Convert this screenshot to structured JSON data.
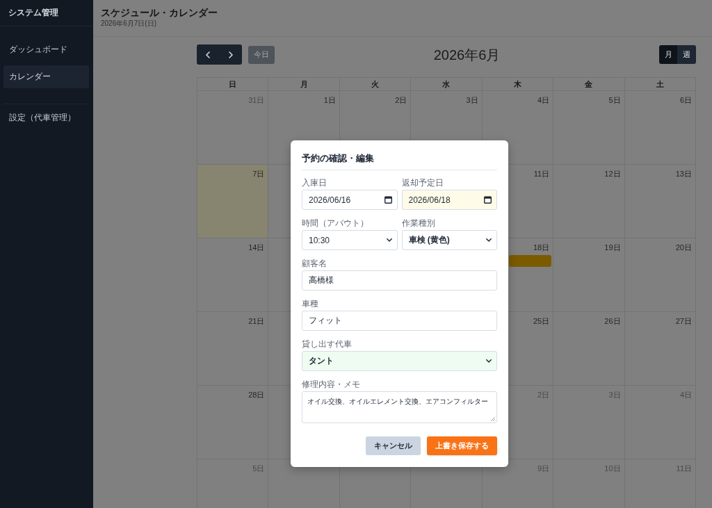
{
  "sidebar": {
    "title": "システム管理",
    "items": [
      {
        "label": "ダッシュボード",
        "selected": false
      },
      {
        "label": "カレンダー",
        "selected": true
      }
    ],
    "bottom_items": [
      {
        "label": "設定（代車管理）",
        "selected": false
      }
    ]
  },
  "header": {
    "title": "スケジュール・カレンダー",
    "date": "2026年6月7日(日)"
  },
  "toolbar": {
    "today_button": {
      "label": "今日",
      "disabled": true
    },
    "month_title": "2026年6月",
    "view_toggle": [
      {
        "label": "月",
        "selected": true
      },
      {
        "label": "週",
        "selected": false
      }
    ]
  },
  "calendar": {
    "weekdays": [
      "日",
      "月",
      "火",
      "水",
      "木",
      "金",
      "土"
    ],
    "weeks": [
      {
        "cells": [
          {
            "day": "31日",
            "other_month": true,
            "today": false
          },
          {
            "day": "1日",
            "other_month": false,
            "today": false
          },
          {
            "day": "2日",
            "other_month": false,
            "today": false
          },
          {
            "day": "3日",
            "other_month": false,
            "today": false
          },
          {
            "day": "4日",
            "other_month": false,
            "today": false
          },
          {
            "day": "5日",
            "other_month": false,
            "today": false
          },
          {
            "day": "6日",
            "other_month": false,
            "today": false
          }
        ]
      },
      {
        "cells": [
          {
            "day": "7日",
            "other_month": false,
            "today": true
          }
        ],
        "cells_right_of_dialog": [
          {
            "day": "11日",
            "other_month": false,
            "today": false
          },
          {
            "day": "12日",
            "other_month": false,
            "today": false
          },
          {
            "day": "13日",
            "other_month": false,
            "today": false
          }
        ]
      },
      {
        "cells": [
          {
            "day": "14日",
            "other_month": false,
            "today": false
          }
        ],
        "cells_right_of_dialog": [
          {
            "day": "18日",
            "other_month": false,
            "today": false,
            "events": [
              {
                "color": "#7b5b00"
              }
            ]
          },
          {
            "day": "19日",
            "other_month": false,
            "today": false
          },
          {
            "day": "20日",
            "other_month": false,
            "today": false
          }
        ]
      },
      {
        "cells": [
          {
            "day": "21日",
            "other_month": false,
            "today": false
          }
        ],
        "cells_right_of_dialog": [
          {
            "day": "25日",
            "other_month": false,
            "today": false
          },
          {
            "day": "26日",
            "other_month": false,
            "today": false
          },
          {
            "day": "27日",
            "other_month": false,
            "today": false
          }
        ]
      },
      {
        "cells": [
          {
            "day": "28日",
            "other_month": false,
            "today": false
          }
        ],
        "cells_right_of_dialog": [
          {
            "day": "2日",
            "other_month": true,
            "today": false
          },
          {
            "day": "3日",
            "other_month": true,
            "today": false
          },
          {
            "day": "4日",
            "other_month": true,
            "today": false
          }
        ]
      },
      {
        "cells": [
          {
            "day": "5日",
            "other_month": true,
            "today": false
          }
        ],
        "cells_right_of_dialog": [
          {
            "day": "9日",
            "other_month": true,
            "today": false
          },
          {
            "day": "10日",
            "other_month": true,
            "today": false
          },
          {
            "day": "11日",
            "other_month": true,
            "today": false
          }
        ]
      }
    ]
  },
  "modal": {
    "title": "予約の確認・編集",
    "rows": [
      [
        {
          "label": "入庫日",
          "kind": "date",
          "value": "2026/06/16",
          "color": "#ffffff",
          "strong": false
        },
        {
          "label": "返却予定日",
          "kind": "date",
          "value": "2026/06/18",
          "color": "#fefbe8",
          "strong": false
        }
      ],
      [
        {
          "label": "時間（アバウト）",
          "kind": "select",
          "value": "10:30",
          "color": "#ffffff",
          "strong": false
        },
        {
          "label": "作業種別",
          "kind": "select",
          "value": "車検 (黄色)",
          "color": "#ffffff",
          "strong": true
        }
      ],
      [
        {
          "label": "顧客名",
          "kind": "text",
          "value": "高橋様",
          "color": "#ffffff",
          "strong": false
        }
      ],
      [
        {
          "label": "車種",
          "kind": "text",
          "value": "フィット",
          "color": "#ffffff",
          "strong": false
        }
      ],
      [
        {
          "label": "貸し出す代車",
          "kind": "select",
          "value": "タント",
          "color": "#effcf2",
          "strong": true
        }
      ],
      [
        {
          "label": "修理内容・メモ",
          "kind": "textarea",
          "value": "オイル交換、オイルエレメント交換、エアコンフィルター",
          "color": "#ffffff",
          "strong": false
        }
      ]
    ],
    "buttons": [
      {
        "label": "キャンセル",
        "kind": "secondary"
      },
      {
        "label": "上書き保存する",
        "kind": "primary"
      }
    ]
  }
}
